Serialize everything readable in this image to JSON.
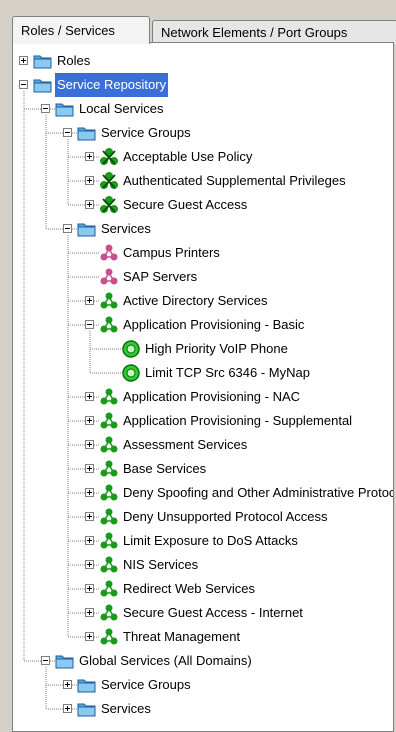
{
  "tabs": [
    {
      "label": "Roles / Services",
      "active": true
    },
    {
      "label": "Network Elements / Port Groups",
      "active": false
    }
  ],
  "colors": {
    "selection": "#3a6fd8",
    "service_green": "#1a9a1a",
    "service_pink": "#c8508c",
    "folder_blue": "#5aa8e0",
    "rule_green": "#2ecc2e"
  },
  "tree": [
    {
      "label": "Roles",
      "level": 0,
      "icon": "folder-icon",
      "expander": "plus"
    },
    {
      "label": "Service Repository",
      "level": 0,
      "icon": "folder-icon",
      "expander": "minus",
      "selected": true
    },
    {
      "label": "Local Services",
      "level": 1,
      "icon": "folder-icon",
      "expander": "minus"
    },
    {
      "label": "Service Groups",
      "level": 2,
      "icon": "folder-icon",
      "expander": "minus"
    },
    {
      "label": "Acceptable Use Policy",
      "level": 3,
      "icon": "service-group-icon",
      "expander": "plus"
    },
    {
      "label": "Authenticated Supplemental Privileges",
      "level": 3,
      "icon": "service-group-icon",
      "expander": "plus"
    },
    {
      "label": "Secure Guest Access",
      "level": 3,
      "icon": "service-group-icon",
      "expander": "plus"
    },
    {
      "label": "Services",
      "level": 2,
      "icon": "folder-icon",
      "expander": "minus"
    },
    {
      "label": "Campus Printers",
      "level": 3,
      "icon": "pink-service-icon",
      "expander": "none"
    },
    {
      "label": "SAP Servers",
      "level": 3,
      "icon": "pink-service-icon",
      "expander": "none"
    },
    {
      "label": "Active Directory Services",
      "level": 3,
      "icon": "service-icon",
      "expander": "plus"
    },
    {
      "label": "Application Provisioning - Basic",
      "level": 3,
      "icon": "service-icon",
      "expander": "minus"
    },
    {
      "label": "High Priority VoIP Phone",
      "level": 4,
      "icon": "rule-icon",
      "expander": "none"
    },
    {
      "label": "Limit TCP Src 6346 - MyNap",
      "level": 4,
      "icon": "rule-icon",
      "expander": "none"
    },
    {
      "label": "Application Provisioning - NAC",
      "level": 3,
      "icon": "service-icon",
      "expander": "plus"
    },
    {
      "label": "Application Provisioning - Supplemental",
      "level": 3,
      "icon": "service-icon",
      "expander": "plus"
    },
    {
      "label": "Assessment Services",
      "level": 3,
      "icon": "service-icon",
      "expander": "plus"
    },
    {
      "label": "Base Services",
      "level": 3,
      "icon": "service-icon",
      "expander": "plus"
    },
    {
      "label": "Deny Spoofing and Other Administrative Protocols",
      "level": 3,
      "icon": "service-icon",
      "expander": "plus"
    },
    {
      "label": "Deny Unsupported Protocol Access",
      "level": 3,
      "icon": "service-icon",
      "expander": "plus"
    },
    {
      "label": "Limit Exposure to DoS Attacks",
      "level": 3,
      "icon": "service-icon",
      "expander": "plus"
    },
    {
      "label": "NIS Services",
      "level": 3,
      "icon": "service-icon",
      "expander": "plus"
    },
    {
      "label": "Redirect Web Services",
      "level": 3,
      "icon": "service-icon",
      "expander": "plus"
    },
    {
      "label": "Secure Guest Access - Internet",
      "level": 3,
      "icon": "service-icon",
      "expander": "plus"
    },
    {
      "label": "Threat Management",
      "level": 3,
      "icon": "service-icon",
      "expander": "plus"
    },
    {
      "label": "Global Services (All Domains)",
      "level": 1,
      "icon": "folder-icon",
      "expander": "minus"
    },
    {
      "label": "Service Groups",
      "level": 2,
      "icon": "folder-icon",
      "expander": "plus"
    },
    {
      "label": "Services",
      "level": 2,
      "icon": "folder-icon",
      "expander": "plus"
    }
  ]
}
